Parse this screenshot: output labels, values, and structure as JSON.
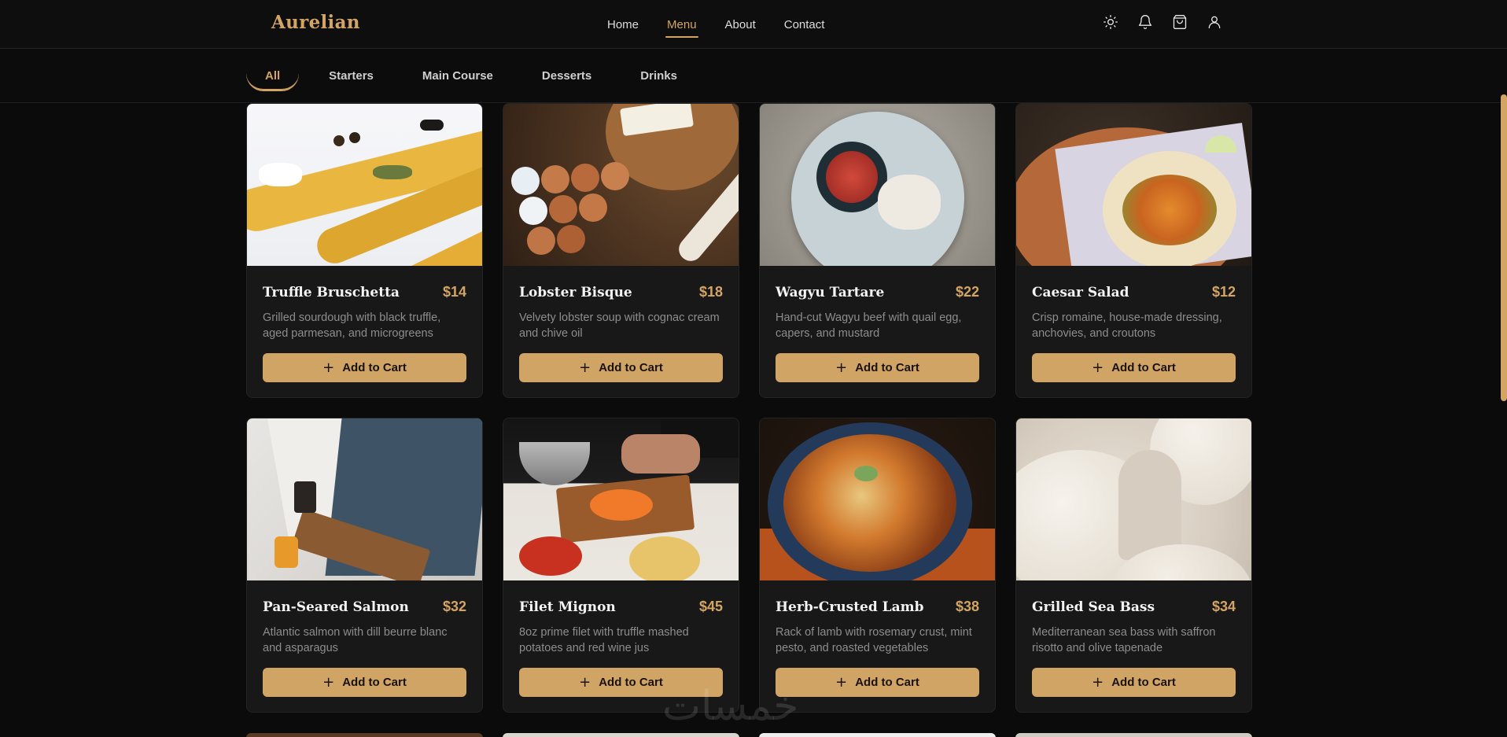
{
  "brand": {
    "name": "Aurelian",
    "accent": "#d4a562"
  },
  "nav": {
    "items": [
      {
        "label": "Home",
        "active": false
      },
      {
        "label": "Menu",
        "active": true
      },
      {
        "label": "About",
        "active": false
      },
      {
        "label": "Contact",
        "active": false
      }
    ]
  },
  "header_icons": [
    "sun-icon",
    "bell-icon",
    "shopping-bag-icon",
    "user-icon"
  ],
  "categories": [
    {
      "label": "All",
      "active": true
    },
    {
      "label": "Starters",
      "active": false
    },
    {
      "label": "Main Course",
      "active": false
    },
    {
      "label": "Desserts",
      "active": false
    },
    {
      "label": "Drinks",
      "active": false
    }
  ],
  "menu_items": [
    {
      "name": "Truffle Bruschetta",
      "price": "$14",
      "description": "Grilled sourdough with black truffle, aged parmesan, and microgreens",
      "button": "Add to Cart"
    },
    {
      "name": "Lobster Bisque",
      "price": "$18",
      "description": "Velvety lobster soup with cognac cream and chive oil",
      "button": "Add to Cart"
    },
    {
      "name": "Wagyu Tartare",
      "price": "$22",
      "description": "Hand-cut Wagyu beef with quail egg, capers, and mustard",
      "button": "Add to Cart"
    },
    {
      "name": "Caesar Salad",
      "price": "$12",
      "description": "Crisp romaine, house-made dressing, anchovies, and croutons",
      "button": "Add to Cart"
    },
    {
      "name": "Pan-Seared Salmon",
      "price": "$32",
      "description": "Atlantic salmon with dill beurre blanc and asparagus",
      "button": "Add to Cart"
    },
    {
      "name": "Filet Mignon",
      "price": "$45",
      "description": "8oz prime filet with truffle mashed potatoes and red wine jus",
      "button": "Add to Cart"
    },
    {
      "name": "Herb-Crusted Lamb",
      "price": "$38",
      "description": "Rack of lamb with rosemary crust, mint pesto, and roasted vegetables",
      "button": "Add to Cart"
    },
    {
      "name": "Grilled Sea Bass",
      "price": "$34",
      "description": "Mediterranean sea bass with saffron risotto and olive tapenade",
      "button": "Add to Cart"
    }
  ],
  "watermark": "خمسات"
}
